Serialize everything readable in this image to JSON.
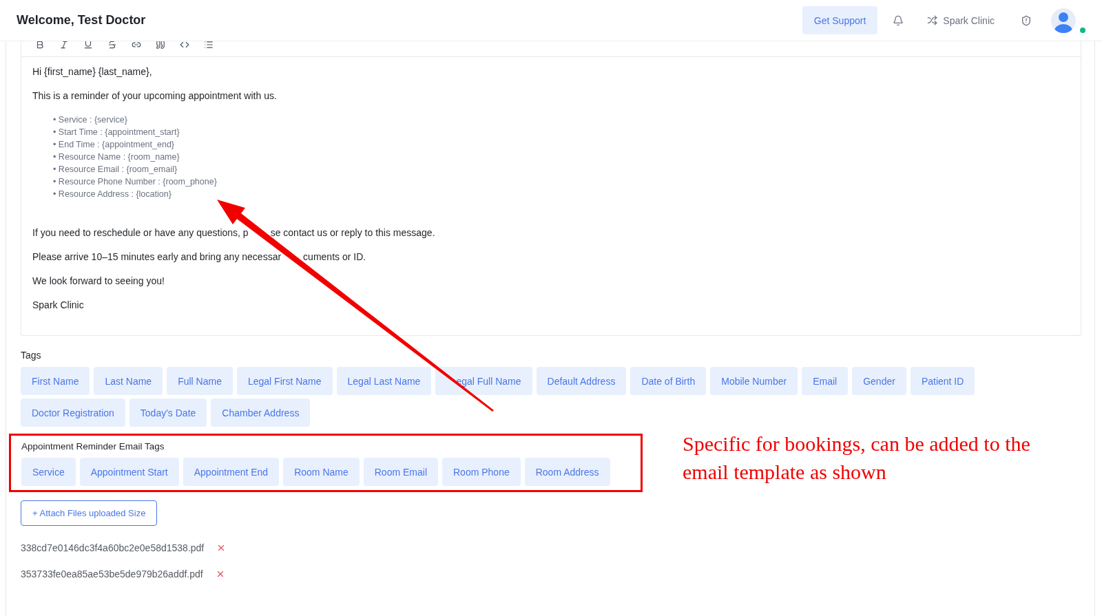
{
  "header": {
    "title": "Welcome, Test Doctor",
    "support_button": "Get Support",
    "clinic": "Spark Clinic",
    "user_online": true
  },
  "editor": {
    "toolbar": [
      {
        "kind": "bold"
      },
      {
        "kind": "italic"
      },
      {
        "kind": "underline"
      },
      {
        "kind": "strike"
      },
      {
        "kind": "link"
      },
      {
        "kind": "quote"
      },
      {
        "kind": "code"
      },
      {
        "kind": "list"
      }
    ],
    "body": [
      {
        "kind": "paragraph",
        "text": "Hi {first_name} {last_name},"
      },
      {
        "kind": "paragraph",
        "text": "This is a reminder of your upcoming appointment with us."
      },
      {
        "kind": "list",
        "items": [
          "• Service : {service}",
          "• Start Time : {appointment_start}",
          "• End Time : {appointment_end}",
          "• Resource Name : {room_name}",
          "• Resource Email : {room_email}",
          "• Resource Phone Number : {room_phone}",
          "• Resource Address : {location}"
        ]
      },
      {
        "kind": "covered_paragraph",
        "parts": [
          "If you need to reschedule or have any questions, p",
          "se contact us or reply to this message."
        ]
      },
      {
        "kind": "covered_paragraph",
        "parts": [
          "Please arrive 10–15 minutes early and bring any necessar",
          "cuments or ID."
        ]
      },
      {
        "kind": "paragraph",
        "text": "We look forward to seeing you!"
      },
      {
        "kind": "paragraph",
        "text": "Spark Clinic"
      }
    ]
  },
  "tags": {
    "label": "Tags",
    "items": [
      {
        "label": "First Name",
        "covered": false
      },
      {
        "label": "Last Name",
        "covered": false
      },
      {
        "label": "Full Name",
        "covered": false
      },
      {
        "label": "Legal First Name",
        "covered": false
      },
      {
        "label": "Legal Last Name",
        "covered": false
      },
      {
        "label": "egal Full Name",
        "covered": true
      },
      {
        "label": "Default Address",
        "covered": false
      },
      {
        "label": "Date of Birth",
        "covered": false
      },
      {
        "label": "Mobile Number",
        "covered": false
      },
      {
        "label": "Email",
        "covered": false
      },
      {
        "label": "Gender",
        "covered": false
      },
      {
        "label": "Patient ID",
        "covered": false
      },
      {
        "label": "Doctor Registration",
        "covered": false
      },
      {
        "label": "Today's Date",
        "covered": false
      },
      {
        "label": "Chamber Address",
        "covered": false
      }
    ]
  },
  "reminder_tags": {
    "label": "Appointment Reminder Email Tags",
    "highlighted": true,
    "items": [
      "Service",
      "Appointment Start",
      "Appointment End",
      "Room Name",
      "Room Email",
      "Room Phone",
      "Room Address"
    ]
  },
  "annotation": {
    "text": "Specific for bookings, can be added to the email template as shown"
  },
  "attach_button": "+ Attach Files uploaded Size",
  "files": [
    "338cd7e0146dc3f4a60bc2e0e58d1538.pdf",
    "353733fe0ea85ae53be5de979b26addf.pdf"
  ]
}
